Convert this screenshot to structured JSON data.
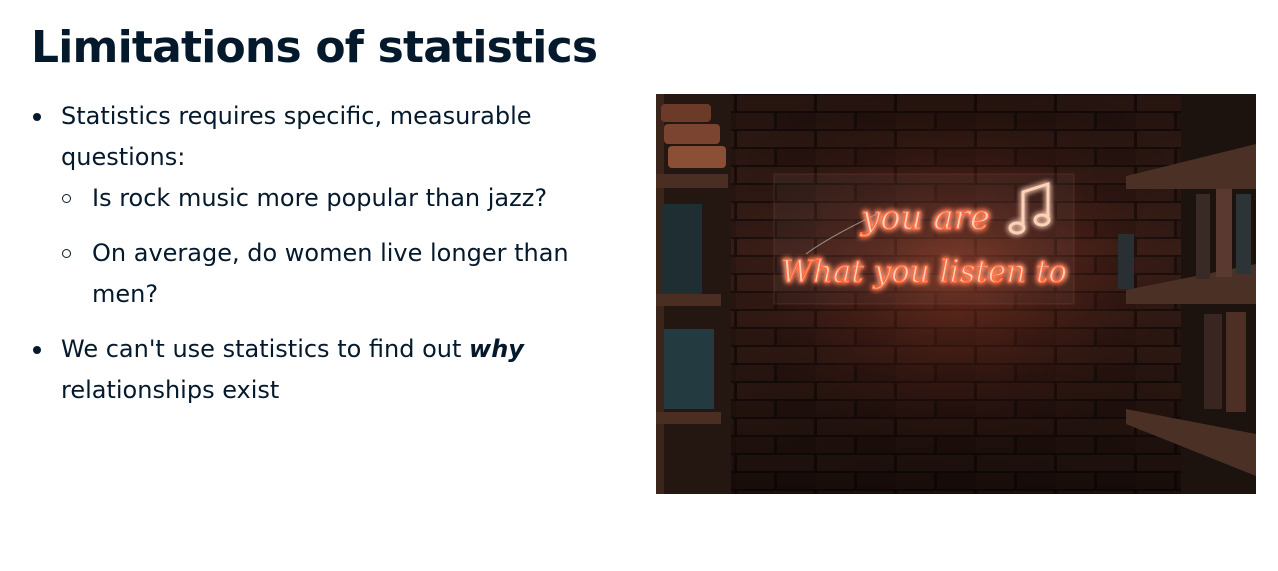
{
  "slide": {
    "title": "Limitations of statistics",
    "bullets": [
      {
        "text": "Statistics requires specific, measurable questions:",
        "sub": [
          "Is rock music more popular than jazz?",
          "On average, do women live longer than men?"
        ]
      },
      {
        "text_before": "We can't use statistics to find out ",
        "emphasis": "why",
        "text_after": " relationships exist"
      }
    ]
  },
  "image": {
    "neon_line1": "you are",
    "neon_line2": "What you listen to",
    "icon": "music-note-icon",
    "neon_color": "#ff6a3d"
  },
  "colors": {
    "text": "#05192d",
    "background": "#ffffff"
  }
}
